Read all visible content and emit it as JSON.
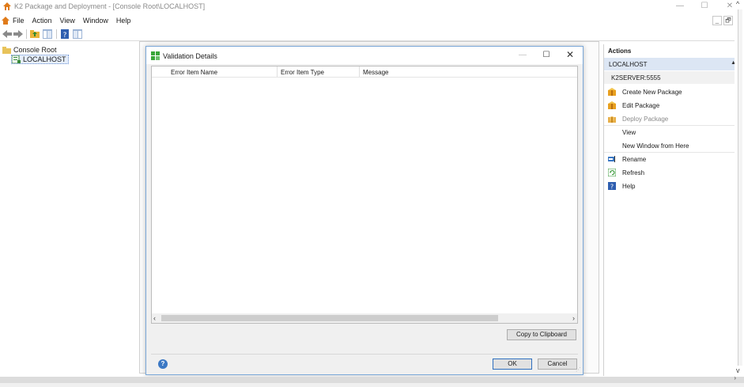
{
  "window": {
    "title": "K2 Package and Deployment - [Console Root\\LOCALHOST]",
    "min_glyph": "—",
    "max_glyph": "☐",
    "close_glyph": "✕"
  },
  "menu": {
    "items": [
      "File",
      "Action",
      "View",
      "Window",
      "Help"
    ],
    "mdi_min": "_",
    "mdi_restore": "🗗"
  },
  "tree": {
    "root_label": "Console Root",
    "child_label": "LOCALHOST"
  },
  "dialog": {
    "title": "Validation Details",
    "min_glyph": "—",
    "max_glyph": "☐",
    "close_glyph": "✕",
    "columns": [
      "Error Item Name",
      "Error Item Type",
      "Message"
    ],
    "rows": [],
    "scroll_left": "‹",
    "scroll_right": "›",
    "copy_label": "Copy to Clipboard",
    "help_glyph": "?",
    "ok_label": "OK",
    "cancel_label": "Cancel"
  },
  "actions": {
    "header": "Actions",
    "group": "LOCALHOST",
    "group_arrow": "▲",
    "subheader": "K2SERVER:5555",
    "items": [
      {
        "label": "Create New Package",
        "icon": "package-icon",
        "enabled": true
      },
      {
        "label": "Edit Package",
        "icon": "edit-package-icon",
        "enabled": true
      },
      {
        "label": "Deploy Package",
        "icon": "deploy-package-icon",
        "enabled": false
      },
      {
        "label": "View",
        "icon": "",
        "enabled": true
      },
      {
        "label": "New Window from Here",
        "icon": "",
        "enabled": true
      },
      {
        "label": "Rename",
        "icon": "rename-icon",
        "enabled": true
      },
      {
        "label": "Refresh",
        "icon": "refresh-icon",
        "enabled": true
      },
      {
        "label": "Help",
        "icon": "help-icon",
        "enabled": true
      }
    ]
  },
  "colors": {
    "accent": "#3b78c4",
    "selection": "#dce6f4",
    "dialog_border": "#7aa7d8"
  }
}
